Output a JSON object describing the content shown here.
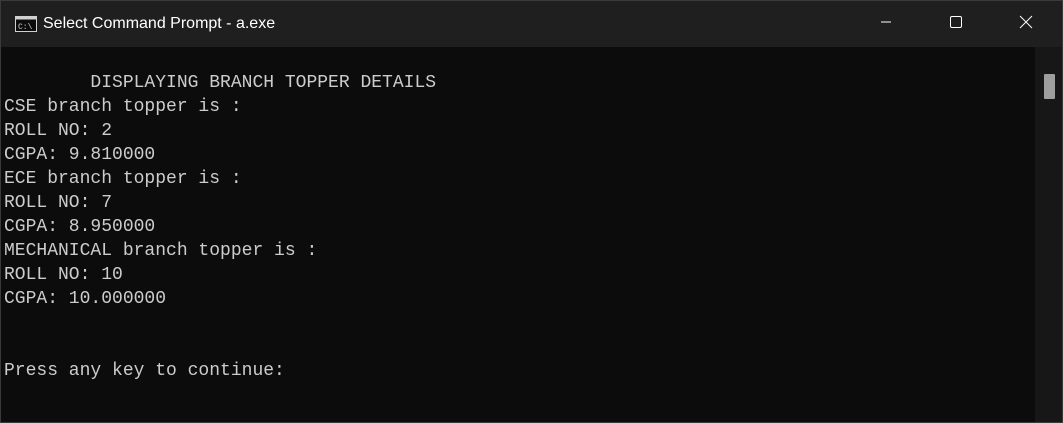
{
  "window": {
    "title": "Select Command Prompt - a.exe",
    "icon": "command-prompt-icon",
    "controls": {
      "minimize": "minimize-icon",
      "maximize": "maximize-icon",
      "close": "close-icon"
    }
  },
  "terminal": {
    "lines": [
      "        DISPLAYING BRANCH TOPPER DETAILS",
      "CSE branch topper is :",
      "ROLL NO: 2",
      "CGPA: 9.810000",
      "ECE branch topper is :",
      "ROLL NO: 7",
      "CGPA: 8.950000",
      "MECHANICAL branch topper is :",
      "ROLL NO: 10",
      "CGPA: 10.000000",
      "",
      "",
      "Press any key to continue:"
    ]
  },
  "colors": {
    "background": "#0c0c0c",
    "titlebar": "#1f1f1f",
    "text": "#cccccc"
  }
}
